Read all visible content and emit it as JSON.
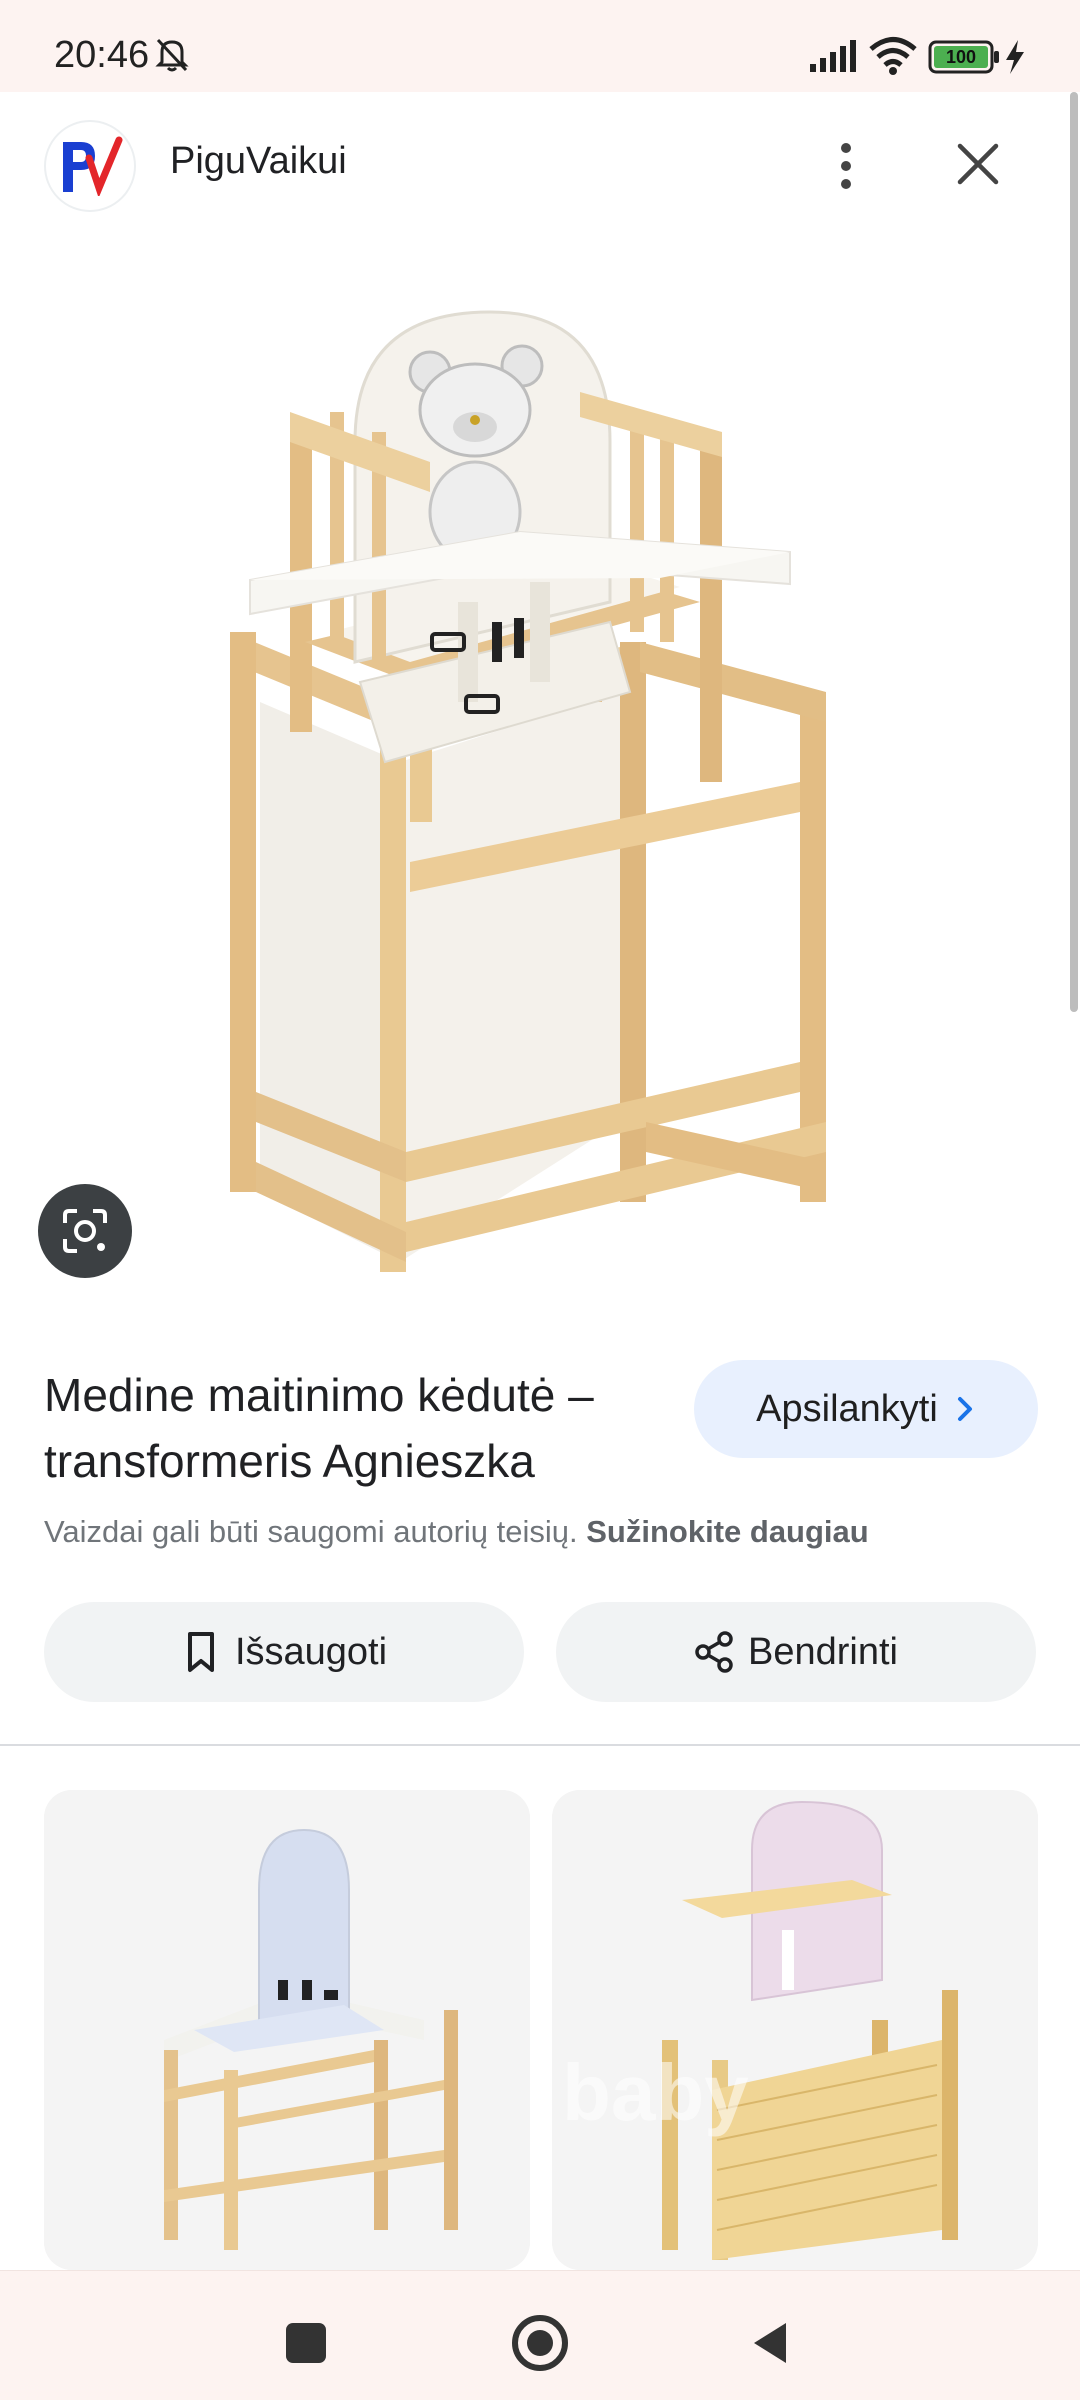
{
  "status": {
    "time": "20:46",
    "battery": "100"
  },
  "header": {
    "site_logo_text": "PV",
    "site_name": "PiguVaikui"
  },
  "product": {
    "title": "Medine maitinimo kėdutė – transformeris Agnieszka",
    "visit_label": "Apsilankyti",
    "copyright_text": "Vaizdai gali būti saugomi autorių teisių.",
    "learn_more": "Sužinokite daugiau"
  },
  "actions": {
    "save_label": "Išsaugoti",
    "share_label": "Bendrinti"
  },
  "related": {
    "watermark": "baby"
  },
  "colors": {
    "status_bg": "#fdf3f1",
    "visit_bg": "#e8f0fe",
    "pill_bg": "#f1f3f4",
    "wood": "#e6c48f",
    "logo_blue": "#1a3fd1",
    "logo_red": "#e3262a"
  },
  "icons": [
    "bell-off-icon",
    "signal-icon",
    "wifi-icon",
    "battery-icon",
    "charging-icon",
    "more-vert-icon",
    "close-icon",
    "lens-icon",
    "chevron-right-icon",
    "bookmark-icon",
    "share-icon"
  ]
}
